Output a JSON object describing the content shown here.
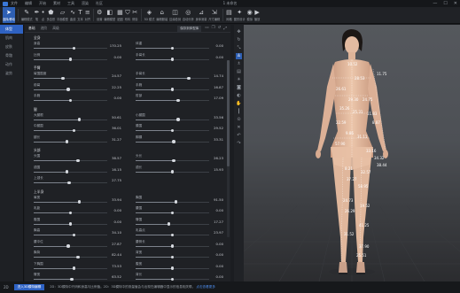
{
  "menubar": {
    "items": [
      "文件",
      "编辑",
      "开始",
      "素材",
      "工具",
      "渲染",
      "社区"
    ],
    "window_title": "1 未命名",
    "controls": [
      "—",
      "☐",
      "✕"
    ]
  },
  "toolbar": {
    "buttons": [
      {
        "label": "选择/移动",
        "icon": "arrow-icon"
      },
      {
        "label": "编辑模式",
        "icon": "edit-icon"
      },
      {
        "label": "笔",
        "icon": "pen-icon"
      },
      {
        "label": "点",
        "icon": "point-icon"
      },
      {
        "label": "多边形",
        "icon": "polygon-icon"
      },
      {
        "label": "平面模型",
        "icon": "plane-icon"
      },
      {
        "label": "曲线",
        "icon": "curve-icon"
      },
      {
        "label": "文本",
        "icon": "text-icon"
      },
      {
        "label": "对齐",
        "icon": "align-icon"
      },
      {
        "label": "设置",
        "icon": "settings-icon"
      },
      {
        "label": "编辑模型",
        "icon": "model-icon"
      },
      {
        "label": "贴图",
        "icon": "texture-icon"
      },
      {
        "label": "布料",
        "icon": "cloth-icon"
      },
      {
        "label": "修剪",
        "icon": "trim-icon"
      },
      {
        "label": "3D 模式",
        "icon": "3d-icon"
      },
      {
        "label": "编辑服装",
        "icon": "garment-icon"
      },
      {
        "label": "边缘检测",
        "icon": "edge-icon"
      },
      {
        "label": "自动分析",
        "icon": "analyze-icon"
      },
      {
        "label": "身体测量",
        "icon": "measure-icon"
      },
      {
        "label": "尺寸编辑",
        "icon": "size-icon"
      },
      {
        "label": "网格",
        "icon": "grid-icon"
      },
      {
        "label": "图形设计",
        "icon": "design-icon"
      },
      {
        "label": "模拟",
        "icon": "simulate-icon"
      },
      {
        "label": "播放",
        "icon": "play-icon"
      }
    ]
  },
  "leftnav": {
    "items": [
      "体型",
      "肌肉",
      "皮肤",
      "骨骼",
      "动作",
      "姿势"
    ]
  },
  "panel": {
    "tabs": [
      "基础",
      "进阶",
      "高级"
    ],
    "save_button": "保存到体型库",
    "groups": [
      {
        "title": "全身",
        "params": [
          [
            {
              "label": "身高",
              "value": "170.25",
              "fill": 0.55
            },
            {
              "label": "体重",
              "value": "0.00",
              "fill": 0.5
            }
          ],
          [
            {
              "label": "比例",
              "value": "0.00",
              "fill": 0.5
            },
            {
              "label": "手臂长",
              "value": "0.00",
              "fill": 0.5
            }
          ]
        ]
      },
      {
        "title": "手臂",
        "params": [
          [
            {
              "label": "臂围围度",
              "value": "24.57",
              "fill": 0.4
            },
            {
              "label": "手臂长",
              "value": "14.74",
              "fill": 0.72
            }
          ],
          [
            {
              "label": "前臂",
              "value": "22.25",
              "fill": 0.47
            },
            {
              "label": "手腕",
              "value": "16.87",
              "fill": 0.5
            }
          ],
          [
            {
              "label": "手腕",
              "value": "0.00",
              "fill": 0.5
            },
            {
              "label": "肘部",
              "value": "17.09",
              "fill": 0.58
            }
          ]
        ]
      },
      {
        "title": "腿",
        "params": [
          [
            {
              "label": "大腿根",
              "value": "50.61",
              "fill": 0.62
            },
            {
              "label": "小腿围",
              "value": "33.56",
              "fill": 0.58
            }
          ],
          [
            {
              "label": "中腿围",
              "value": "36.01",
              "fill": 0.55
            },
            {
              "label": "膝围",
              "value": "29.52",
              "fill": 0.5
            }
          ],
          [
            {
              "label": "腿长",
              "value": "31.27",
              "fill": 0.45
            },
            {
              "label": "脚踝",
              "value": "33.31",
              "fill": 0.52
            }
          ]
        ]
      },
      {
        "title": "头部",
        "params": [
          [
            {
              "label": "头围",
              "value": "38.57",
              "fill": 0.6
            },
            {
              "label": "头长",
              "value": "26.23",
              "fill": 0.52
            }
          ],
          [
            {
              "label": "颈围",
              "value": "16.15",
              "fill": 0.45
            },
            {
              "label": "颈长",
              "value": "15.93",
              "fill": 0.5
            }
          ],
          [
            {
              "label": "上颈长",
              "value": "27.75",
              "fill": 0.48
            },
            {
              "label": "",
              "value": "",
              "fill": 0
            }
          ]
        ]
      },
      {
        "title": "上半身",
        "params": [
          [
            {
              "label": "肩宽",
              "value": "33.94",
              "fill": 0.62
            },
            {
              "label": "胸围",
              "value": "91.50",
              "fill": 0.55
            }
          ],
          [
            {
              "label": "乳距",
              "value": "0.00",
              "fill": 0.5
            },
            {
              "label": "腰围",
              "value": "0.00",
              "fill": 0.5
            }
          ],
          [
            {
              "label": "腹围",
              "value": "0.00",
              "fill": 0.5
            },
            {
              "label": "臀围",
              "value": "17.27",
              "fill": 0.45
            }
          ],
          [
            {
              "label": "胸高",
              "value": "34.10",
              "fill": 0.55
            },
            {
              "label": "乳高点",
              "value": "23.97",
              "fill": 0.5
            }
          ],
          [
            {
              "label": "腰中位",
              "value": "27.87",
              "fill": 0.47
            },
            {
              "label": "腰侧长",
              "value": "0.00",
              "fill": 0.5
            }
          ],
          [
            {
              "label": "胸背",
              "value": "82.44",
              "fill": 0.6
            },
            {
              "label": "背宽",
              "value": "0.00",
              "fill": 0.5
            }
          ],
          [
            {
              "label": "下胸围",
              "value": "73.53",
              "fill": 0.55
            },
            {
              "label": "腹宽",
              "value": "0.00",
              "fill": 0.5
            }
          ],
          [
            {
              "label": "臀宽",
              "value": "63.52",
              "fill": 0.52
            },
            {
              "label": "背长",
              "value": "0.00",
              "fill": 0.5
            }
          ]
        ]
      }
    ]
  },
  "viewport": {
    "tools": [
      "move-icon",
      "rotate-icon",
      "scale-icon",
      "person-icon",
      "mannequin-icon",
      "grid-icon",
      "light-icon",
      "camera-icon",
      "shading-icon",
      "hand-icon",
      "ruler-icon",
      "pin-icon",
      "delete-icon",
      "undo-icon",
      "redo-icon"
    ],
    "measurement_labels": [
      "10.52",
      "28.53",
      "11.75",
      "26.61",
      "29.30",
      "24.75",
      "35.26",
      "25.31",
      "11.83",
      "22.59",
      "8.87",
      "9.86",
      "31.11",
      "57.90",
      "33.16",
      "34.32",
      "38.44",
      "8.21",
      "32.57",
      "37.27",
      "58.95",
      "24.73",
      "19.52",
      "26.29",
      "41.25",
      "31.52",
      "37.90",
      "25.51"
    ]
  },
  "statusbar": {
    "label": "2D",
    "button": "进入3D模特编辑",
    "message": "2D：3D模特中尺码和身高与比例值。2D：3D模特中的测量值会与出现在编辑器中显示的信息相关联。",
    "link": "点击查看更多"
  },
  "colors": {
    "accent": "#2e62c4",
    "background": "#1b1d21",
    "skin": "#e3bba1",
    "measurement": "#ffffff"
  }
}
